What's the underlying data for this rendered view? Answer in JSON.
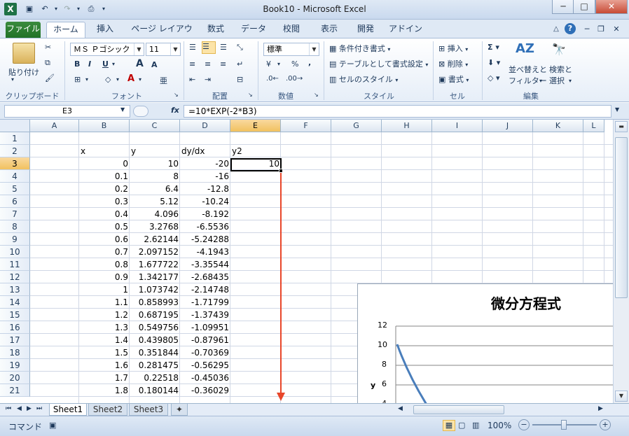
{
  "window": {
    "title": "Book10 - Microsoft Excel",
    "minimize": "─",
    "maximize": "□",
    "close": "✕"
  },
  "tabs": [
    "ファイル",
    "ホーム",
    "挿入",
    "ページ レイアウト",
    "数式",
    "データ",
    "校閲",
    "表示",
    "開発",
    "アドイン"
  ],
  "active_tab": "ホーム",
  "ribbon": {
    "clipboard": {
      "paste": "貼り付け",
      "label": "クリップボード"
    },
    "font": {
      "name": "ＭＳ Ｐゴシック",
      "size": "11",
      "bold": "B",
      "italic": "I",
      "underline": "U",
      "grow": "A",
      "shrink": "A",
      "color_a": "A",
      "label": "フォント"
    },
    "alignment": {
      "label": "配置"
    },
    "number": {
      "format": "標準",
      "percent": "%",
      "comma": ",",
      "label": "数値"
    },
    "styles": {
      "conditional": "条件付き書式",
      "table": "テーブルとして書式設定",
      "cell_style": "セルのスタイル",
      "label": "スタイル"
    },
    "cells": {
      "insert": "挿入",
      "delete": "削除",
      "format": "書式",
      "label": "セル"
    },
    "editing": {
      "sort": "並べ替えと",
      "filter": "フィルター",
      "find": "検索と",
      "select": "選択",
      "label": "編集"
    }
  },
  "formula_bar": {
    "name_box": "E3",
    "fx": "fx",
    "formula": "=10*EXP(-2*B3)"
  },
  "columns": [
    "A",
    "B",
    "C",
    "D",
    "E",
    "F",
    "G",
    "H",
    "I",
    "J",
    "K",
    "L"
  ],
  "selected_column": "E",
  "selected_row": "3",
  "rows": [
    {
      "r": "1",
      "A": "",
      "B": "",
      "C": "",
      "D": "",
      "E": ""
    },
    {
      "r": "2",
      "A": "",
      "B": "x",
      "C": "y",
      "D": "dy/dx",
      "E": "y2"
    },
    {
      "r": "3",
      "A": "",
      "B": "0",
      "C": "10",
      "D": "-20",
      "E": "10"
    },
    {
      "r": "4",
      "A": "",
      "B": "0.1",
      "C": "8",
      "D": "-16",
      "E": ""
    },
    {
      "r": "5",
      "A": "",
      "B": "0.2",
      "C": "6.4",
      "D": "-12.8",
      "E": ""
    },
    {
      "r": "6",
      "A": "",
      "B": "0.3",
      "C": "5.12",
      "D": "-10.24",
      "E": ""
    },
    {
      "r": "7",
      "A": "",
      "B": "0.4",
      "C": "4.096",
      "D": "-8.192",
      "E": ""
    },
    {
      "r": "8",
      "A": "",
      "B": "0.5",
      "C": "3.2768",
      "D": "-6.5536",
      "E": ""
    },
    {
      "r": "9",
      "A": "",
      "B": "0.6",
      "C": "2.62144",
      "D": "-5.24288",
      "E": ""
    },
    {
      "r": "10",
      "A": "",
      "B": "0.7",
      "C": "2.097152",
      "D": "-4.1943",
      "E": ""
    },
    {
      "r": "11",
      "A": "",
      "B": "0.8",
      "C": "1.677722",
      "D": "-3.35544",
      "E": ""
    },
    {
      "r": "12",
      "A": "",
      "B": "0.9",
      "C": "1.342177",
      "D": "-2.68435",
      "E": ""
    },
    {
      "r": "13",
      "A": "",
      "B": "1",
      "C": "1.073742",
      "D": "-2.14748",
      "E": ""
    },
    {
      "r": "14",
      "A": "",
      "B": "1.1",
      "C": "0.858993",
      "D": "-1.71799",
      "E": ""
    },
    {
      "r": "15",
      "A": "",
      "B": "1.2",
      "C": "0.687195",
      "D": "-1.37439",
      "E": ""
    },
    {
      "r": "16",
      "A": "",
      "B": "1.3",
      "C": "0.549756",
      "D": "-1.09951",
      "E": ""
    },
    {
      "r": "17",
      "A": "",
      "B": "1.4",
      "C": "0.439805",
      "D": "-0.87961",
      "E": ""
    },
    {
      "r": "18",
      "A": "",
      "B": "1.5",
      "C": "0.351844",
      "D": "-0.70369",
      "E": ""
    },
    {
      "r": "19",
      "A": "",
      "B": "1.6",
      "C": "0.281475",
      "D": "-0.56295",
      "E": ""
    },
    {
      "r": "20",
      "A": "",
      "B": "1.7",
      "C": "0.22518",
      "D": "-0.45036",
      "E": ""
    },
    {
      "r": "21",
      "A": "",
      "B": "1.8",
      "C": "0.180144",
      "D": "-0.36029",
      "E": ""
    }
  ],
  "chart": {
    "title": "微分方程式",
    "y_axis_label": "y",
    "y_ticks": [
      "12",
      "10",
      "8",
      "6",
      "4"
    ]
  },
  "sheet_tabs": [
    "Sheet1",
    "Sheet2",
    "Sheet3"
  ],
  "active_sheet": "Sheet1",
  "status": {
    "mode": "コマンド",
    "zoom": "100%",
    "zoom_out": "−",
    "zoom_in": "+"
  },
  "colors": {
    "accent_green": "#217227",
    "selection_orange": "#f1c15f",
    "arrow_red": "#e8462a",
    "chart_line": "#4a7ebb"
  }
}
